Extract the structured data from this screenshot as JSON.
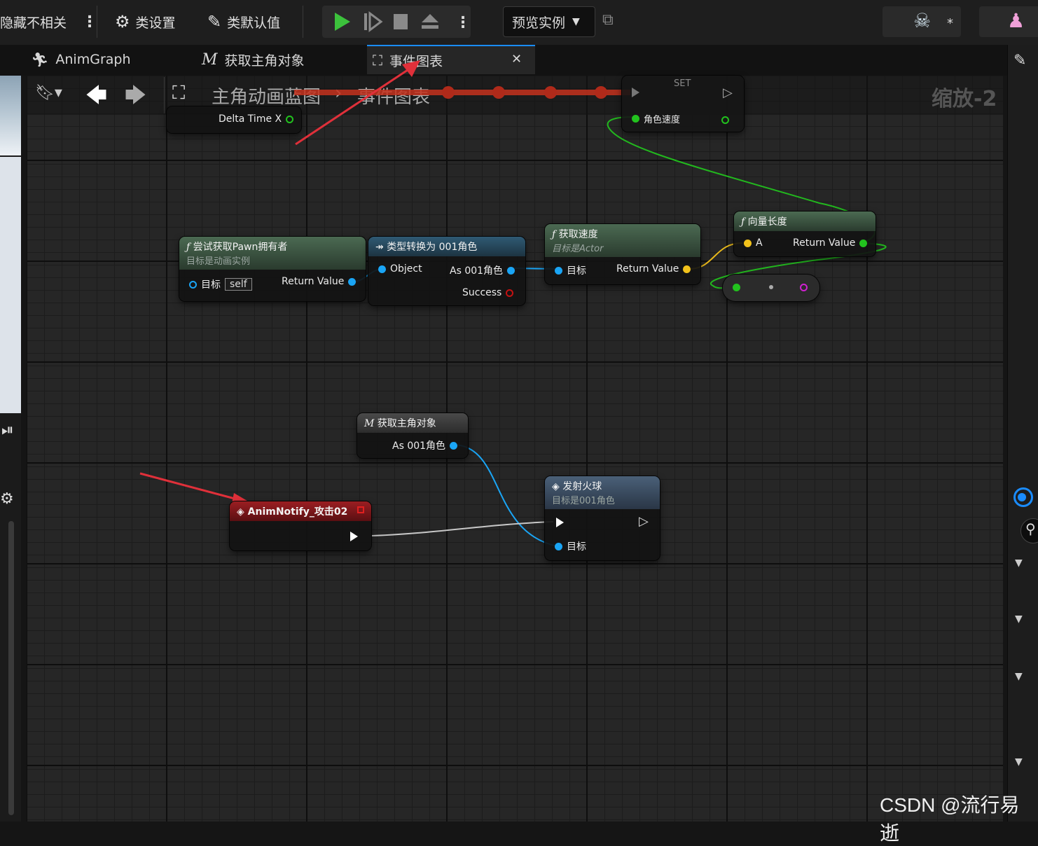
{
  "toolbar": {
    "hide_unrelated": "隐藏不相关",
    "class_settings": "类设置",
    "class_defaults": "类默认值",
    "preview_instance": "预览实例"
  },
  "tabs": [
    {
      "label": "AnimGraph"
    },
    {
      "label": "获取主角对象"
    },
    {
      "label": "事件图表"
    }
  ],
  "breadcrumb": {
    "root": "主角动画蓝图",
    "current": "事件图表",
    "zoom": "缩放-2"
  },
  "nodes": {
    "delta": {
      "pin": "Delta Time X"
    },
    "set": {
      "title": "SET",
      "pin": "角色速度"
    },
    "try_get_pawn": {
      "title": "尝试获取Pawn拥有者",
      "subtitle": "目标是动画实例",
      "target": "目标",
      "self": "self",
      "ret": "Return Value"
    },
    "cast": {
      "title": "类型转换为 001角色",
      "object": "Object",
      "as": "As 001角色",
      "success": "Success"
    },
    "get_velocity": {
      "title": "获取速度",
      "subtitle": "目标是Actor",
      "target": "目标",
      "ret": "Return Value"
    },
    "vector_length": {
      "title": "向量长度",
      "a": "A",
      "ret": "Return Value"
    },
    "get_main_char": {
      "title": "获取主角对象",
      "as": "As 001角色"
    },
    "fire": {
      "title": "发射火球",
      "subtitle": "目标是001角色",
      "target": "目标"
    },
    "notify": {
      "title": "AnimNotify_攻击02"
    }
  },
  "watermark": "CSDN @流行易逝",
  "colors": {
    "accent": "#1a8cff",
    "exec_wire": "#d8d8d8",
    "object_wire": "#1aa5f5",
    "float_wire": "#22c21e",
    "arrow": "#e0303a"
  }
}
